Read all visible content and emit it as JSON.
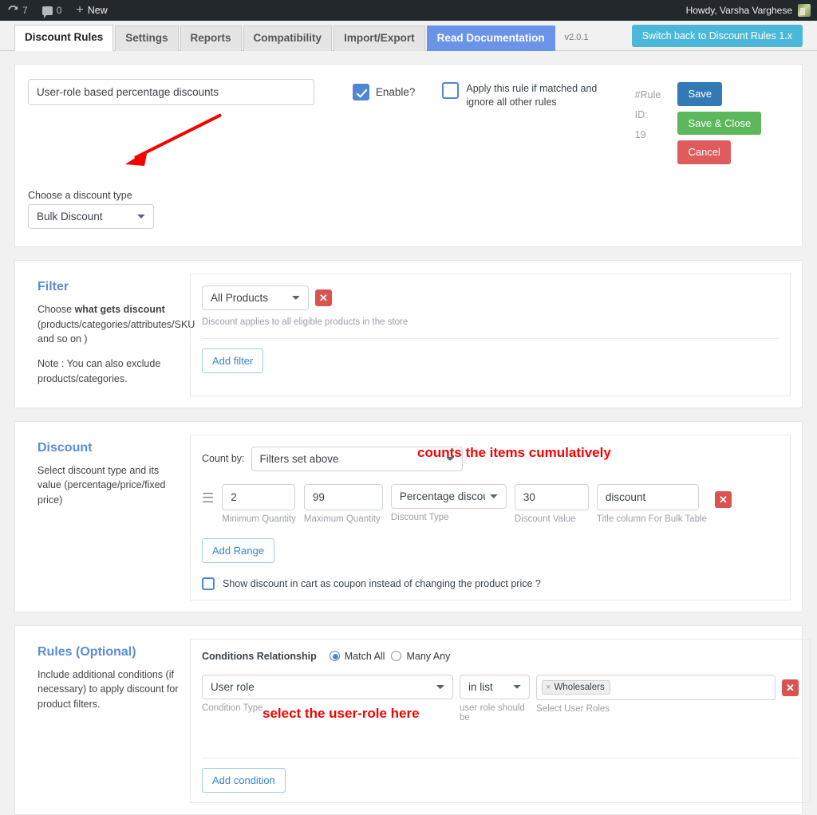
{
  "adminbar": {
    "updates_count": "7",
    "comments_count": "0",
    "new_label": "New",
    "howdy": "Howdy, Varsha Varghese"
  },
  "tabs": [
    {
      "label": "Discount Rules",
      "active": true
    },
    {
      "label": "Settings",
      "active": false
    },
    {
      "label": "Reports",
      "active": false
    },
    {
      "label": "Compatibility",
      "active": false
    },
    {
      "label": "Import/Export",
      "active": false
    },
    {
      "label": "Read Documentation",
      "active": false,
      "style": "doc"
    }
  ],
  "version": "v2.0.1",
  "switch_button": "Switch back to Discount Rules 1.x",
  "rule": {
    "name_value": "User-role based percentage discounts",
    "enable_label": "Enable?",
    "enable_checked": true,
    "apply_label": "Apply this rule if matched and ignore all other rules",
    "apply_checked": false,
    "rule_id_label": "#Rule ID:",
    "rule_id_value": "19",
    "save_label": "Save",
    "save_close_label": "Save & Close",
    "cancel_label": "Cancel",
    "discount_type_label": "Choose a discount type",
    "discount_type_value": "Bulk Discount"
  },
  "filter": {
    "title": "Filter",
    "desc_1": "Choose ",
    "desc_1_bold": "what gets discount",
    "desc_1_rest": " (products/categories/attributes/SKU and so on )",
    "desc_2": "Note : You can also exclude products/categories.",
    "select_value": "All Products",
    "hint": "Discount applies to all eligible products in the store",
    "add_button": "Add filter"
  },
  "discount": {
    "title": "Discount",
    "desc": "Select discount type and its value (percentage/price/fixed price)",
    "count_by_label": "Count by:",
    "count_by_value": "Filters set above",
    "annotation": "counts the items cumulatively",
    "min_qty_value": "2",
    "min_qty_label": "Minimum Quantity",
    "max_qty_value": "99",
    "max_qty_label": "Maximum Quantity",
    "discount_type_value": "Percentage discount",
    "discount_type_label": "Discount Type",
    "discount_value": "30",
    "discount_value_label": "Discount Value",
    "title_column_value": "discount",
    "title_column_label": "Title column For Bulk Table",
    "add_range_button": "Add Range",
    "coupon_checkbox_label": "Show discount in cart as coupon instead of changing the product price ?",
    "coupon_checked": false
  },
  "rules": {
    "title": "Rules (Optional)",
    "desc": "Include additional conditions (if necessary) to apply discount for product filters.",
    "relationship_label": "Conditions Relationship",
    "match_all_label": "Match All",
    "many_any_label": "Many Any",
    "relationship_selected": "Match All",
    "condition_type_value": "User role",
    "condition_type_label": "Condition Type",
    "operator_value": "in list",
    "operator_label": "user role should be",
    "roles_tag": "Wholesalers",
    "roles_label": "Select User Roles",
    "annotation": "select the user-role here",
    "add_condition_button": "Add condition"
  },
  "colors": {
    "accent_blue": "#5b8dd4",
    "doc_tab": "#6b93e8",
    "switch_cyan": "#4bb8da",
    "save_blue": "#337ab7",
    "save_close_green": "#5cb85c",
    "cancel_red": "#e05c5c",
    "delete_red": "#d9534f",
    "annotation_red": "#f80000",
    "adminbar": "#23282d"
  }
}
